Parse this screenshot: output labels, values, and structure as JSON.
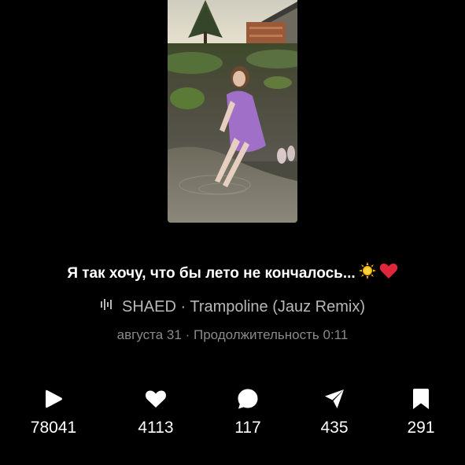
{
  "post": {
    "caption": "Я так хочу, что бы лето не кончалось...",
    "caption_emojis": [
      "sun-emoji",
      "red-heart-emoji"
    ],
    "music": {
      "artist": "SHAED",
      "separator": "·",
      "track": "Trampoline (Jauz Remix)"
    },
    "meta": {
      "date": "августа 31",
      "separator": "·",
      "duration": "Продолжительность 0:11"
    }
  },
  "stats": {
    "views": "78041",
    "likes": "4113",
    "comments": "117",
    "shares": "435",
    "saves": "291"
  },
  "colors": {
    "background": "#000000",
    "text_primary": "#ffffff",
    "text_secondary": "#b8b8b8",
    "text_tertiary": "#8a8a8a",
    "heart": "#e0263a"
  }
}
